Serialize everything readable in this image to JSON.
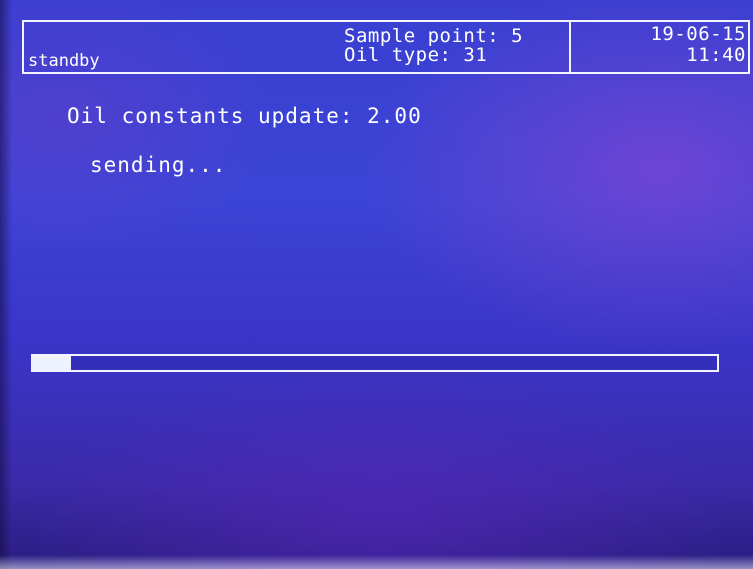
{
  "header": {
    "status": "standby",
    "sample_point": "Sample point: 5",
    "oil_type": "Oil type: 31",
    "date": "19-06-15",
    "time": "11:40"
  },
  "main": {
    "update_message": "Oil constants update: 2.00",
    "sending_message": "sending..."
  },
  "progress": {
    "fraction": 0.056
  },
  "colors": {
    "foreground": "#f2f4ff",
    "background": "#3a3fd0"
  }
}
